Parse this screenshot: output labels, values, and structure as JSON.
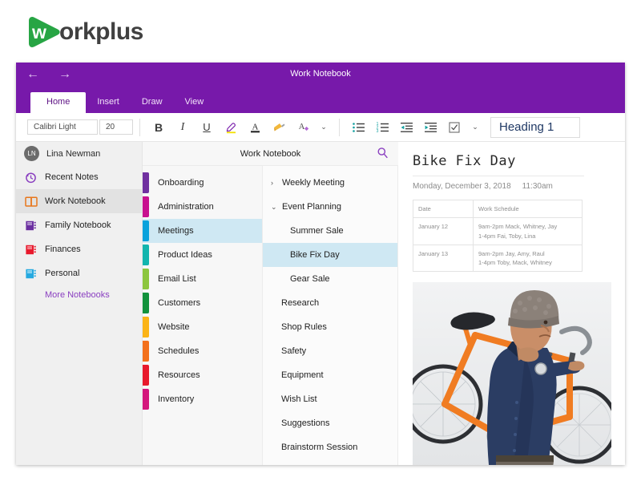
{
  "brand": {
    "mark_letter": "w",
    "name": "orkplus",
    "green": "#27a544",
    "text_color": "#404040"
  },
  "window": {
    "title": "Work Notebook",
    "accent": "#7719aa",
    "nav": {
      "back": "←",
      "forward": "→"
    },
    "tabs": [
      {
        "label": "Home",
        "active": true
      },
      {
        "label": "Insert",
        "active": false
      },
      {
        "label": "Draw",
        "active": false
      },
      {
        "label": "View",
        "active": false
      }
    ]
  },
  "toolbar": {
    "font_name": "Calibri Light",
    "font_size": "20",
    "bold": "B",
    "italic": "I",
    "underline": "U",
    "highlight_icon": "highlighter-icon",
    "font_color_icon": "font-color-icon",
    "format_painter_icon": "format-painter-icon",
    "clear_formatting_icon": "clear-formatting-icon",
    "chevron": "⌄",
    "bullet_list_icon": "bullet-list-icon",
    "numbered_list_icon": "numbered-list-icon",
    "decrease_indent_icon": "decrease-indent-icon",
    "increase_indent_icon": "increase-indent-icon",
    "todo_icon": "checkbox-icon",
    "style_name": "Heading 1"
  },
  "sidebar": {
    "account": {
      "initials": "LN",
      "name": "Lina Newman"
    },
    "notebooks": [
      {
        "label": "Recent Notes",
        "icon": "clock-icon",
        "color": "#8a3fc0",
        "selected": false
      },
      {
        "label": "Work Notebook",
        "icon": "open-book-icon",
        "color": "#e8761b",
        "selected": true
      },
      {
        "label": "Family Notebook",
        "icon": "notebook-icon",
        "color": "#6b2fa0",
        "selected": false
      },
      {
        "label": "Finances",
        "icon": "notebook-icon",
        "color": "#e8192c",
        "selected": false
      },
      {
        "label": "Personal",
        "icon": "notebook-icon",
        "color": "#25a9e0",
        "selected": false
      }
    ],
    "more_notebooks": "More Notebooks"
  },
  "notebook_header": {
    "title": "Work Notebook",
    "search_icon": "search-icon"
  },
  "sections": [
    {
      "label": "Onboarding",
      "color": "#7030a0",
      "selected": false
    },
    {
      "label": "Administration",
      "color": "#c8108f",
      "selected": false
    },
    {
      "label": "Meetings",
      "color": "#0aa2dc",
      "selected": true
    },
    {
      "label": "Product Ideas",
      "color": "#12b5ae",
      "selected": false
    },
    {
      "label": "Email List",
      "color": "#8cc63e",
      "selected": false
    },
    {
      "label": "Customers",
      "color": "#12923c",
      "selected": false
    },
    {
      "label": "Website",
      "color": "#fbb417",
      "selected": false
    },
    {
      "label": "Schedules",
      "color": "#f3701b",
      "selected": false
    },
    {
      "label": "Resources",
      "color": "#e8192c",
      "selected": false
    },
    {
      "label": "Inventory",
      "color": "#d4177c",
      "selected": false
    }
  ],
  "pages": [
    {
      "label": "Weekly Meeting",
      "chevron": "›",
      "level": 0,
      "selected": false
    },
    {
      "label": "Event Planning",
      "chevron": "⌄",
      "level": 0,
      "selected": false
    },
    {
      "label": "Summer Sale",
      "chevron": "",
      "level": 1,
      "selected": false
    },
    {
      "label": "Bike Fix Day",
      "chevron": "",
      "level": 1,
      "selected": true
    },
    {
      "label": "Gear Sale",
      "chevron": "",
      "level": 1,
      "selected": false
    },
    {
      "label": "Research",
      "chevron": "",
      "level": 0,
      "selected": false
    },
    {
      "label": "Shop Rules",
      "chevron": "",
      "level": 0,
      "selected": false
    },
    {
      "label": "Safety",
      "chevron": "",
      "level": 0,
      "selected": false
    },
    {
      "label": "Equipment",
      "chevron": "",
      "level": 0,
      "selected": false
    },
    {
      "label": "Wish List",
      "chevron": "",
      "level": 0,
      "selected": false
    },
    {
      "label": "Suggestions",
      "chevron": "",
      "level": 0,
      "selected": false
    },
    {
      "label": "Brainstorm Session",
      "chevron": "",
      "level": 0,
      "selected": false
    }
  ],
  "note": {
    "title": "Bike Fix Day",
    "date": "Monday, December 3, 2018",
    "time": "11:30am",
    "table": {
      "headers": [
        "Date",
        "Work Schedule"
      ],
      "rows": [
        {
          "date": "January 12",
          "shift1": "9am-2pm Mack, Whitney, Jay",
          "shift2": "1-4pm Fai, Toby, Lina"
        },
        {
          "date": "January 13",
          "shift1": "9am-2pm Jay, Amy, Raul",
          "shift2": "1-4pm Toby, Mack, Whitney"
        }
      ]
    },
    "image_alt": "man-carrying-orange-bicycle-photo"
  }
}
